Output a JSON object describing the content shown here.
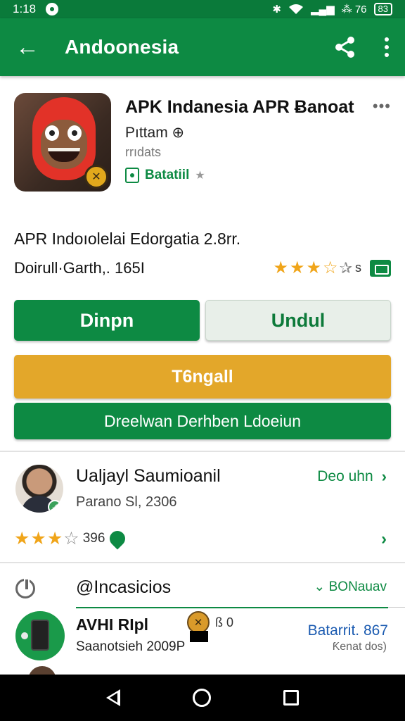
{
  "status_bar": {
    "time": "1:18",
    "right_text": "⁂ 76",
    "battery": "83"
  },
  "app_bar": {
    "title": "Andoonesia",
    "back_icon": "arrow-left-icon",
    "share_icon": "share-icon",
    "more_icon": "more-vert-icon"
  },
  "app": {
    "name": "APK Indanesia APR Ƀanoat",
    "dots": "•••",
    "developer": "Pıttam ⊕",
    "sub": "rrıdats",
    "badge_label": "Batatiil",
    "badge_star": "★"
  },
  "info": {
    "line1": "APR Indoıolelai Edorgatia 2.8rr.",
    "line2": "Doirull·Garth,. 165I",
    "rating_count": "s"
  },
  "buttons": {
    "primary": "Dinpn",
    "secondary": "Undul",
    "gold": "T6ngall",
    "wide_green": "Dreelwan Derhben Ldoeiun"
  },
  "developer_section": {
    "name": "Ualjayl Saumioanil",
    "date": "Parano Sl, 2306",
    "link": "Deo uhn",
    "rating_count": "396"
  },
  "similar": {
    "title": "@Incasicios",
    "more": "⌄ BONauav",
    "item": {
      "name": "AVHI RIpl",
      "extra": "ß 0",
      "sub": "Saanotsieh 2009P",
      "price": "Batarrit. 867",
      "note": "Ƙenat dos)"
    }
  },
  "colors": {
    "primary_green": "#0d8a43",
    "status_green": "#0a7a3a",
    "gold": "#e3a72a",
    "star": "#f0a51a",
    "link_blue": "#1a5ab0"
  }
}
